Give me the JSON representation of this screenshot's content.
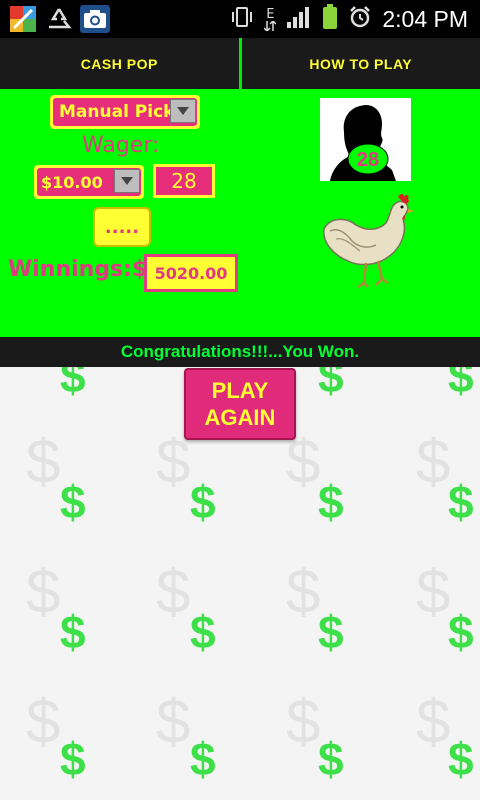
{
  "status_bar": {
    "time": "2:04 PM",
    "network_label": "E",
    "icons": [
      "avg-antivirus-icon",
      "recycle-icon",
      "camera-icon",
      "vibrate-icon",
      "network-e-icon",
      "signal-icon",
      "battery-icon",
      "alarm-icon"
    ]
  },
  "tabs": [
    {
      "label": "CASH POP"
    },
    {
      "label": "HOW TO PLAY"
    }
  ],
  "game": {
    "pick_mode": "Manual Pick",
    "wager_label": "Wager:",
    "wager_value": "$10.00",
    "picked_number": "28",
    "dots_button_label": ".....",
    "winnings_label": "Winnings:$",
    "winnings_value": "5020.00",
    "portrait_number": "28"
  },
  "message": "Congratulations!!!...You Won.",
  "play_again": {
    "line1": "PLAY",
    "line2": "AGAIN"
  },
  "colors": {
    "panel_green": "#00ff00",
    "accent_pink": "#e62e7a",
    "accent_yellow": "#ffff33",
    "message_green": "#00ff33"
  }
}
